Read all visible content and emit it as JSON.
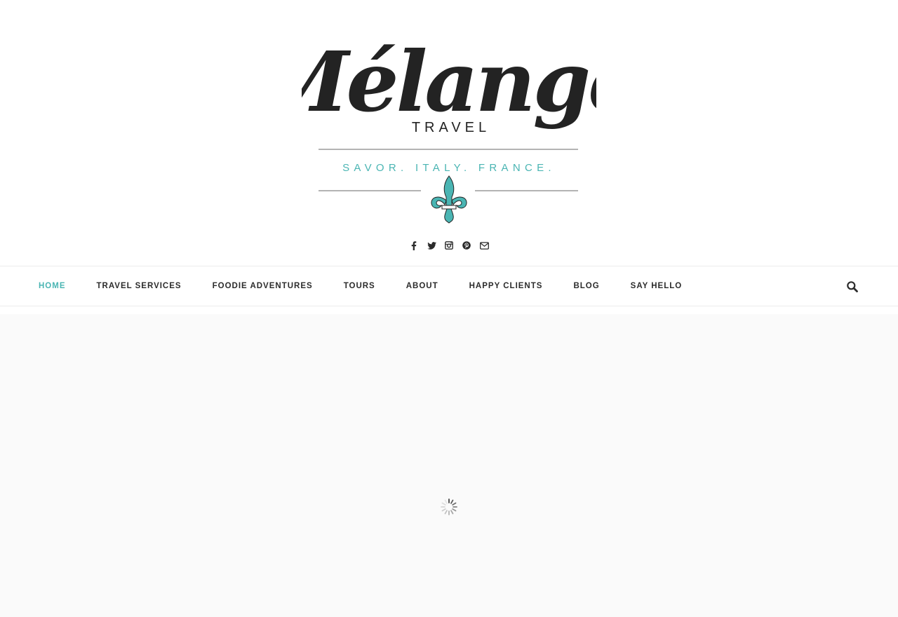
{
  "logo": {
    "script_text": "Mélange",
    "sub_text": "TRAVEL",
    "tagline": "SAVOR. ITALY. FRANCE.",
    "ink_color": "#232323",
    "accent_color": "#4ab5b3"
  },
  "social": [
    {
      "name": "facebook-icon"
    },
    {
      "name": "twitter-icon"
    },
    {
      "name": "instagram-icon"
    },
    {
      "name": "pinterest-icon"
    },
    {
      "name": "email-icon"
    }
  ],
  "nav": {
    "items": [
      {
        "label": "HOME",
        "active": true
      },
      {
        "label": "TRAVEL SERVICES",
        "active": false
      },
      {
        "label": "FOODIE ADVENTURES",
        "active": false
      },
      {
        "label": "TOURS",
        "active": false
      },
      {
        "label": "ABOUT",
        "active": false
      },
      {
        "label": "HAPPY CLIENTS",
        "active": false
      },
      {
        "label": "BLOG",
        "active": false
      },
      {
        "label": "SAY HELLO",
        "active": false
      }
    ],
    "search_icon": "search-icon"
  },
  "content": {
    "loading_icon": "loading-spinner-icon"
  }
}
